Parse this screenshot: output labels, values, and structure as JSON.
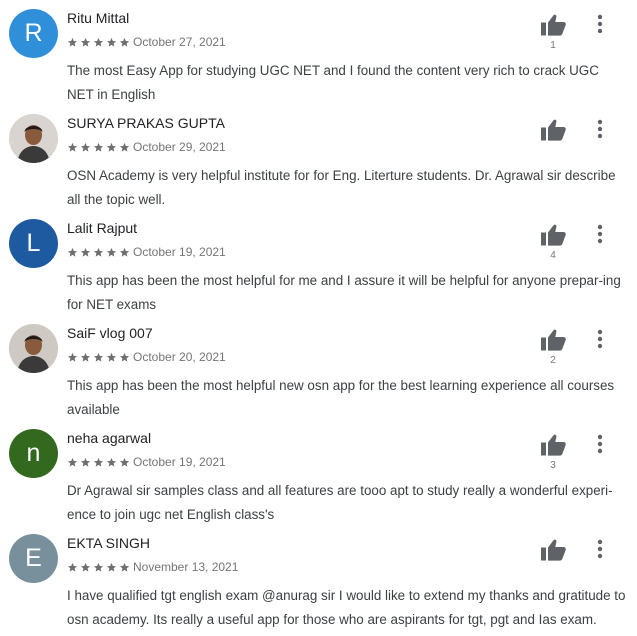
{
  "colors": {
    "star": "#6f6f6f",
    "icon": "#5f6368",
    "date": "#757575",
    "text": "#3c4043"
  },
  "reviews": [
    {
      "name": "Ritu Mittal",
      "avatar": {
        "type": "letter",
        "letter": "R",
        "color": "#2f8fd8"
      },
      "stars": 5,
      "date": "October 27, 2021",
      "helpful": "1",
      "text": "The most Easy App for studying UGC NET and I found the content very rich to crack UGC NET in English"
    },
    {
      "name": "SURYA PRAKAS GUPTA",
      "avatar": {
        "type": "photo",
        "letter": "",
        "color": "#d9d4cf"
      },
      "stars": 5,
      "date": "October 29, 2021",
      "helpful": "",
      "text": "OSN Academy is very helpful institute for for Eng. Literture students. Dr. Agrawal sir describe all the topic well."
    },
    {
      "name": "Lalit Rajput",
      "avatar": {
        "type": "letter",
        "letter": "L",
        "color": "#1e5aa0"
      },
      "stars": 5,
      "date": "October 19, 2021",
      "helpful": "4",
      "text": "This app has been the most helpful for me and I assure it will be helpful for anyone prepar-ing for NET exams"
    },
    {
      "name": "SaiF vlog 007",
      "avatar": {
        "type": "photo",
        "letter": "",
        "color": "#cfc9c4"
      },
      "stars": 5,
      "date": "October 20, 2021",
      "helpful": "2",
      "text": "This app has been the most helpful new osn app for the best learning experience all courses available"
    },
    {
      "name": "neha agarwal",
      "avatar": {
        "type": "letter",
        "letter": "n",
        "color": "#33691e"
      },
      "stars": 5,
      "date": "October 19, 2021",
      "helpful": "3",
      "text": "Dr Agrawal sir samples class and all features are tooo apt to study really a wonderful experi-ence to join ugc net English class's"
    },
    {
      "name": "EKTA SINGH",
      "avatar": {
        "type": "letter",
        "letter": "E",
        "color": "#78909c"
      },
      "stars": 5,
      "date": "November 13, 2021",
      "helpful": "",
      "text": "I have qualified tgt english exam @anurag sir I would like to extend my thanks and gratitude to osn academy. Its really a useful app for those who are aspirants for tgt, pgt and Ias exam."
    }
  ]
}
